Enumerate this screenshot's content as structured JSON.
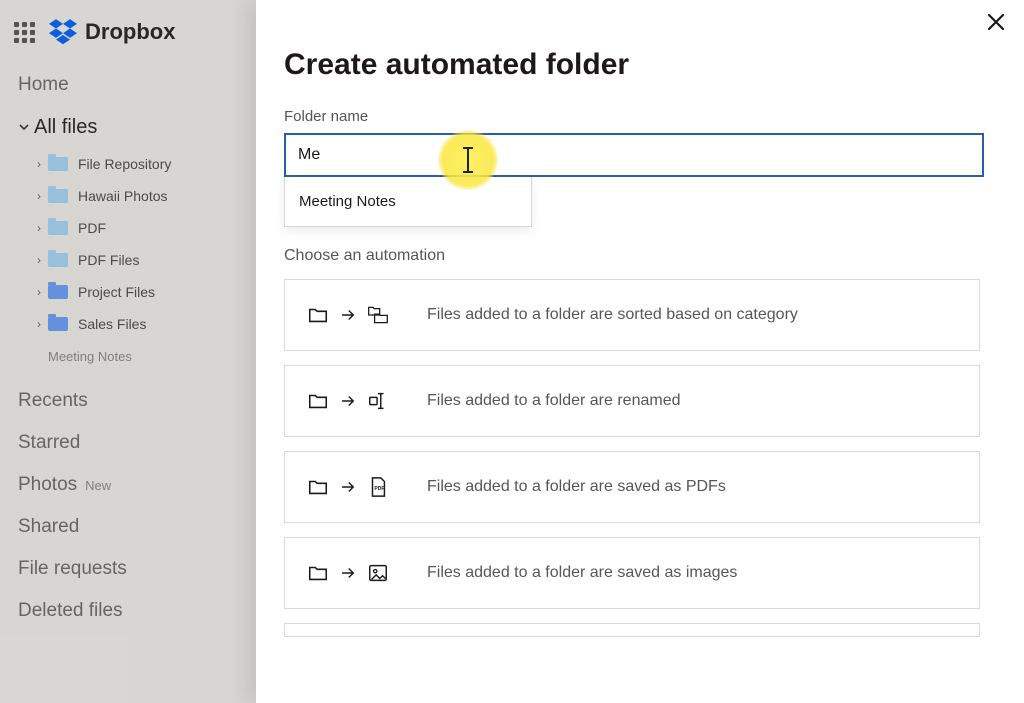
{
  "brand": {
    "name": "Dropbox"
  },
  "sidebar": {
    "home_label": "Home",
    "all_files_label": "All files",
    "tree": [
      {
        "label": "File Repository",
        "shared": false
      },
      {
        "label": "Hawaii Photos",
        "shared": false
      },
      {
        "label": "PDF",
        "shared": false
      },
      {
        "label": "PDF Files",
        "shared": false
      },
      {
        "label": "Project Files",
        "shared": true
      },
      {
        "label": "Sales Files",
        "shared": true
      }
    ],
    "muted_item": "Meeting Notes",
    "recents_label": "Recents",
    "starred_label": "Starred",
    "photos_label": "Photos",
    "photos_badge": "New",
    "shared_label": "Shared",
    "file_requests_label": "File requests",
    "deleted_label": "Deleted files"
  },
  "modal": {
    "title": "Create automated folder",
    "field_label": "Folder name",
    "field_value": "Me",
    "autocomplete": {
      "option": "Meeting Notes"
    },
    "section_label": "Choose an automation",
    "automations": [
      {
        "id": "sort-category",
        "label": "Files added to a folder are sorted based on category"
      },
      {
        "id": "rename",
        "label": "Files added to a folder are renamed"
      },
      {
        "id": "save-pdf",
        "label": "Files added to a folder are saved as PDFs"
      },
      {
        "id": "save-image",
        "label": "Files added to a folder are saved as images"
      }
    ]
  }
}
